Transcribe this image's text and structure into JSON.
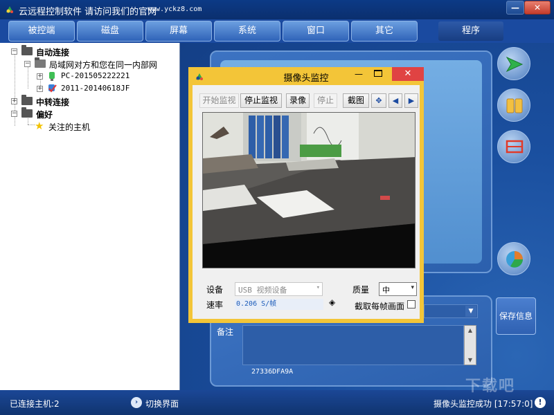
{
  "window": {
    "title": "云远程控制软件 请访问我们的官网",
    "url": "www.yckz8.com",
    "min_label": "—",
    "close_label": "✕"
  },
  "tabs": [
    {
      "label": "被控端"
    },
    {
      "label": "磁盘"
    },
    {
      "label": "屏幕"
    },
    {
      "label": "系统"
    },
    {
      "label": "窗口"
    },
    {
      "label": "其它"
    },
    {
      "label": "程序"
    }
  ],
  "tree": {
    "auto_connect": "自动连接",
    "lan_group": "局域网对方和您在同一内部网",
    "host1": "PC-201505222221",
    "host2": "2011-20140618JF",
    "relay": "中转连接",
    "favorites": "偏好",
    "followed": "关注的主机",
    "expand_minus": "−",
    "expand_plus": "+"
  },
  "right_panel": {
    "notes_label": "备注",
    "id_text": "27336DFA9A",
    "save_label": "保存信息",
    "combo_arrow": "▼",
    "scroll_up": "▲",
    "scroll_down": "▼"
  },
  "status": {
    "connected": "已连接主机:2",
    "switch_label": "切换界面",
    "message": "摄像头监控成功 [17:57:0]",
    "switch_glyph": "›",
    "info_glyph": "!",
    "watermark": "下载吧"
  },
  "camera_dialog": {
    "title": "摄像头监控",
    "min_label": "—",
    "close_label": "✕",
    "buttons": {
      "start": "开始监视",
      "stop_monitor": "停止监视",
      "record": "录像",
      "stop": "停止",
      "screenshot": "截图",
      "fit": "✥",
      "prev": "◀",
      "next": "▶"
    },
    "device_label": "设备",
    "device_value": "USB 视频设备",
    "quality_label": "质量",
    "quality_value": "中",
    "rate_label": "速率",
    "rate_value": "0.206 S/帧",
    "capture_label": "截取每帧画面",
    "capture_checked": false,
    "select_arrow": "▾",
    "spin_glyph": "◈"
  },
  "colors": {
    "dialog_border": "#f3c538",
    "close_red": "#e04343",
    "tab_blue": "#2f63b8"
  }
}
